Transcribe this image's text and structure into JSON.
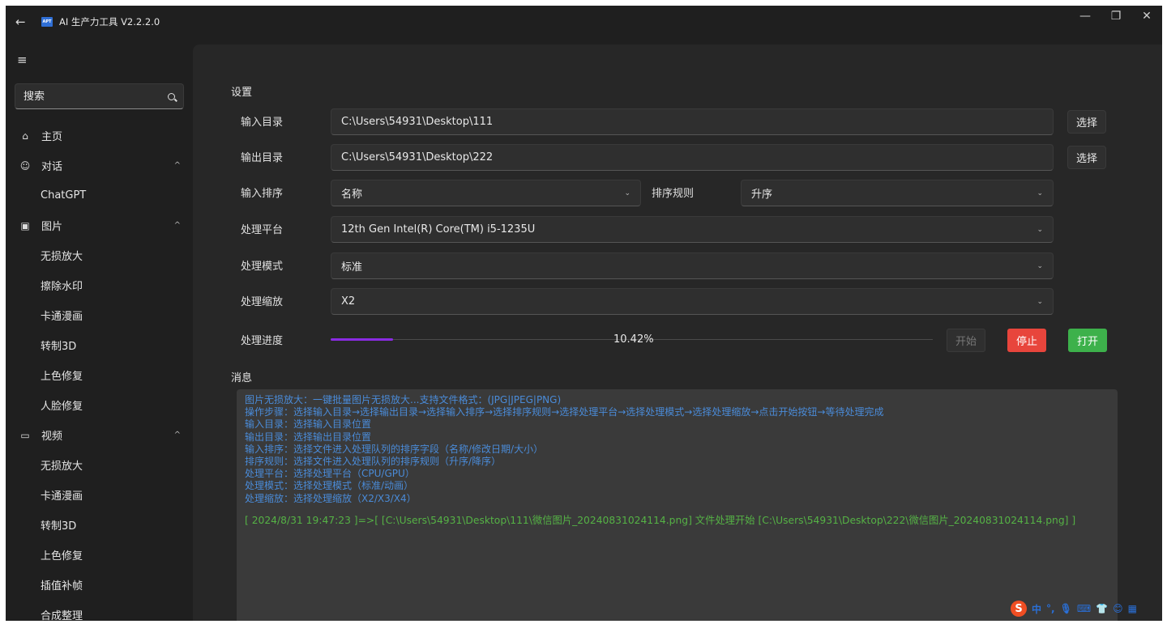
{
  "titlebar": {
    "title": "AI 生产力工具 V2.2.2.0",
    "logo_text": "APT",
    "back_icon": "←",
    "minimize_icon": "—",
    "restore_icon": "❐",
    "close_icon": "✕"
  },
  "sidebar": {
    "menu_icon": "≡",
    "search_placeholder": "搜索",
    "nav": [
      {
        "icon": "⌂",
        "label": "主页"
      },
      {
        "icon": "☺",
        "label": "对话",
        "chevron": "^"
      },
      {
        "label": "ChatGPT"
      },
      {
        "icon": "▣",
        "label": "图片",
        "chevron": "^"
      },
      {
        "label": "无损放大"
      },
      {
        "label": "擦除水印"
      },
      {
        "label": "卡通漫画"
      },
      {
        "label": "转制3D"
      },
      {
        "label": "上色修复"
      },
      {
        "label": "人脸修复"
      },
      {
        "icon": "▭",
        "label": "视频",
        "chevron": "^"
      },
      {
        "label": "无损放大"
      },
      {
        "label": "卡通漫画"
      },
      {
        "label": "转制3D"
      },
      {
        "label": "上色修复"
      },
      {
        "label": "插值补帧"
      },
      {
        "label": "合成整理"
      }
    ]
  },
  "settings": {
    "title": "设置",
    "input_dir_label": "输入目录",
    "input_dir_value": "C:\\Users\\54931\\Desktop\\111",
    "output_dir_label": "输出目录",
    "output_dir_value": "C:\\Users\\54931\\Desktop\\222",
    "select_button": "选择",
    "sort_label": "输入排序",
    "sort_value": "名称",
    "sort_rule_label": "排序规则",
    "sort_rule_value": "升序",
    "platform_label": "处理平台",
    "platform_value": "12th Gen Intel(R) Core(TM) i5-1235U",
    "mode_label": "处理模式",
    "mode_value": "标准",
    "scale_label": "处理缩放",
    "scale_value": "X2",
    "progress_label": "处理进度",
    "progress_text": "10.42%",
    "progress_fraction": 0.1042,
    "start_button": "开始",
    "stop_button": "停止",
    "open_button": "打开",
    "chevron": "⌄"
  },
  "messages": {
    "title": "消息",
    "lines": [
      "图片无损放大：一键批量图片无损放大...支持文件格式：(JPG|JPEG|PNG)",
      "操作步骤：选择输入目录→选择输出目录→选择输入排序→选择排序规则→选择处理平台→选择处理模式→选择处理缩放→点击开始按钮→等待处理完成",
      "输入目录：选择输入目录位置",
      "输出目录：选择输出目录位置",
      "输入排序：选择文件进入处理队列的排序字段（名称/修改日期/大小）",
      "排序规则：选择文件进入处理队列的排序规则（升序/降序）",
      "处理平台：选择处理平台（CPU/GPU）",
      "处理模式：选择处理模式（标准/动画）",
      "处理缩放：选择处理缩放（X2/X3/X4）"
    ],
    "log": "[ 2024/8/31 19:47:23 ]=>[ [C:\\Users\\54931\\Desktop\\111\\微信图片_20240831024114.png] 文件处理开始 [C:\\Users\\54931\\Desktop\\222\\微信图片_20240831024114.png] ]"
  },
  "ime": {
    "logo": "S",
    "mode": "中",
    "punct": "°,",
    "mic": "🎙",
    "keyboard": "⌨",
    "shirt": "👕",
    "emoji": "😊",
    "grid": "▦"
  },
  "colors": {
    "accent_purple": "#8a2be2",
    "stop_red": "#e8453c",
    "open_green": "#3db14b",
    "info_blue": "#4a8bd8",
    "log_green": "#55b245"
  }
}
